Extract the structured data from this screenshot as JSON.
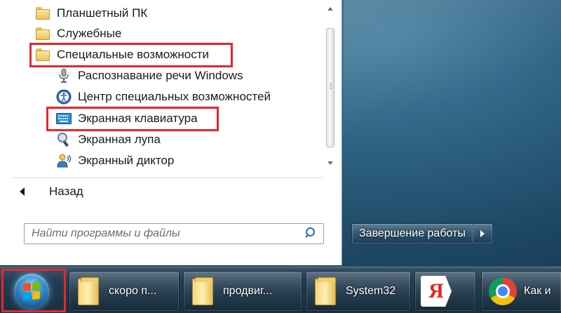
{
  "start_menu": {
    "programs": [
      {
        "label": "Планшетный ПК",
        "icon": "folder-icon",
        "highlighted": false
      },
      {
        "label": "Служебные",
        "icon": "folder-icon",
        "highlighted": false
      },
      {
        "label": "Специальные возможности",
        "icon": "folder-icon",
        "highlighted": true
      },
      {
        "label": "Распознавание речи Windows",
        "icon": "microphone-icon",
        "highlighted": false
      },
      {
        "label": "Центр специальных возможностей",
        "icon": "accessibility-center-icon",
        "highlighted": false
      },
      {
        "label": "Экранная клавиатура",
        "icon": "keyboard-icon",
        "highlighted": true
      },
      {
        "label": "Экранная лупа",
        "icon": "magnifier-icon",
        "highlighted": false
      },
      {
        "label": "Экранный диктор",
        "icon": "narrator-icon",
        "highlighted": false
      }
    ],
    "back_label": "Назад",
    "search_placeholder": "Найти программы и файлы",
    "shutdown_label": "Завершение работы"
  },
  "taskbar": {
    "items": [
      {
        "label": "скоро п...",
        "icon": "folder-icon"
      },
      {
        "label": "продвиг...",
        "icon": "folder-icon"
      },
      {
        "label": "System32",
        "icon": "folder-icon"
      },
      {
        "label": "",
        "icon": "yandex-icon",
        "glyph": "Я"
      },
      {
        "label": "Как и",
        "icon": "chrome-icon"
      }
    ]
  },
  "colors": {
    "highlight_border": "#e8262a",
    "glass": "#2a5f7f",
    "taskbar": "#233d52"
  }
}
